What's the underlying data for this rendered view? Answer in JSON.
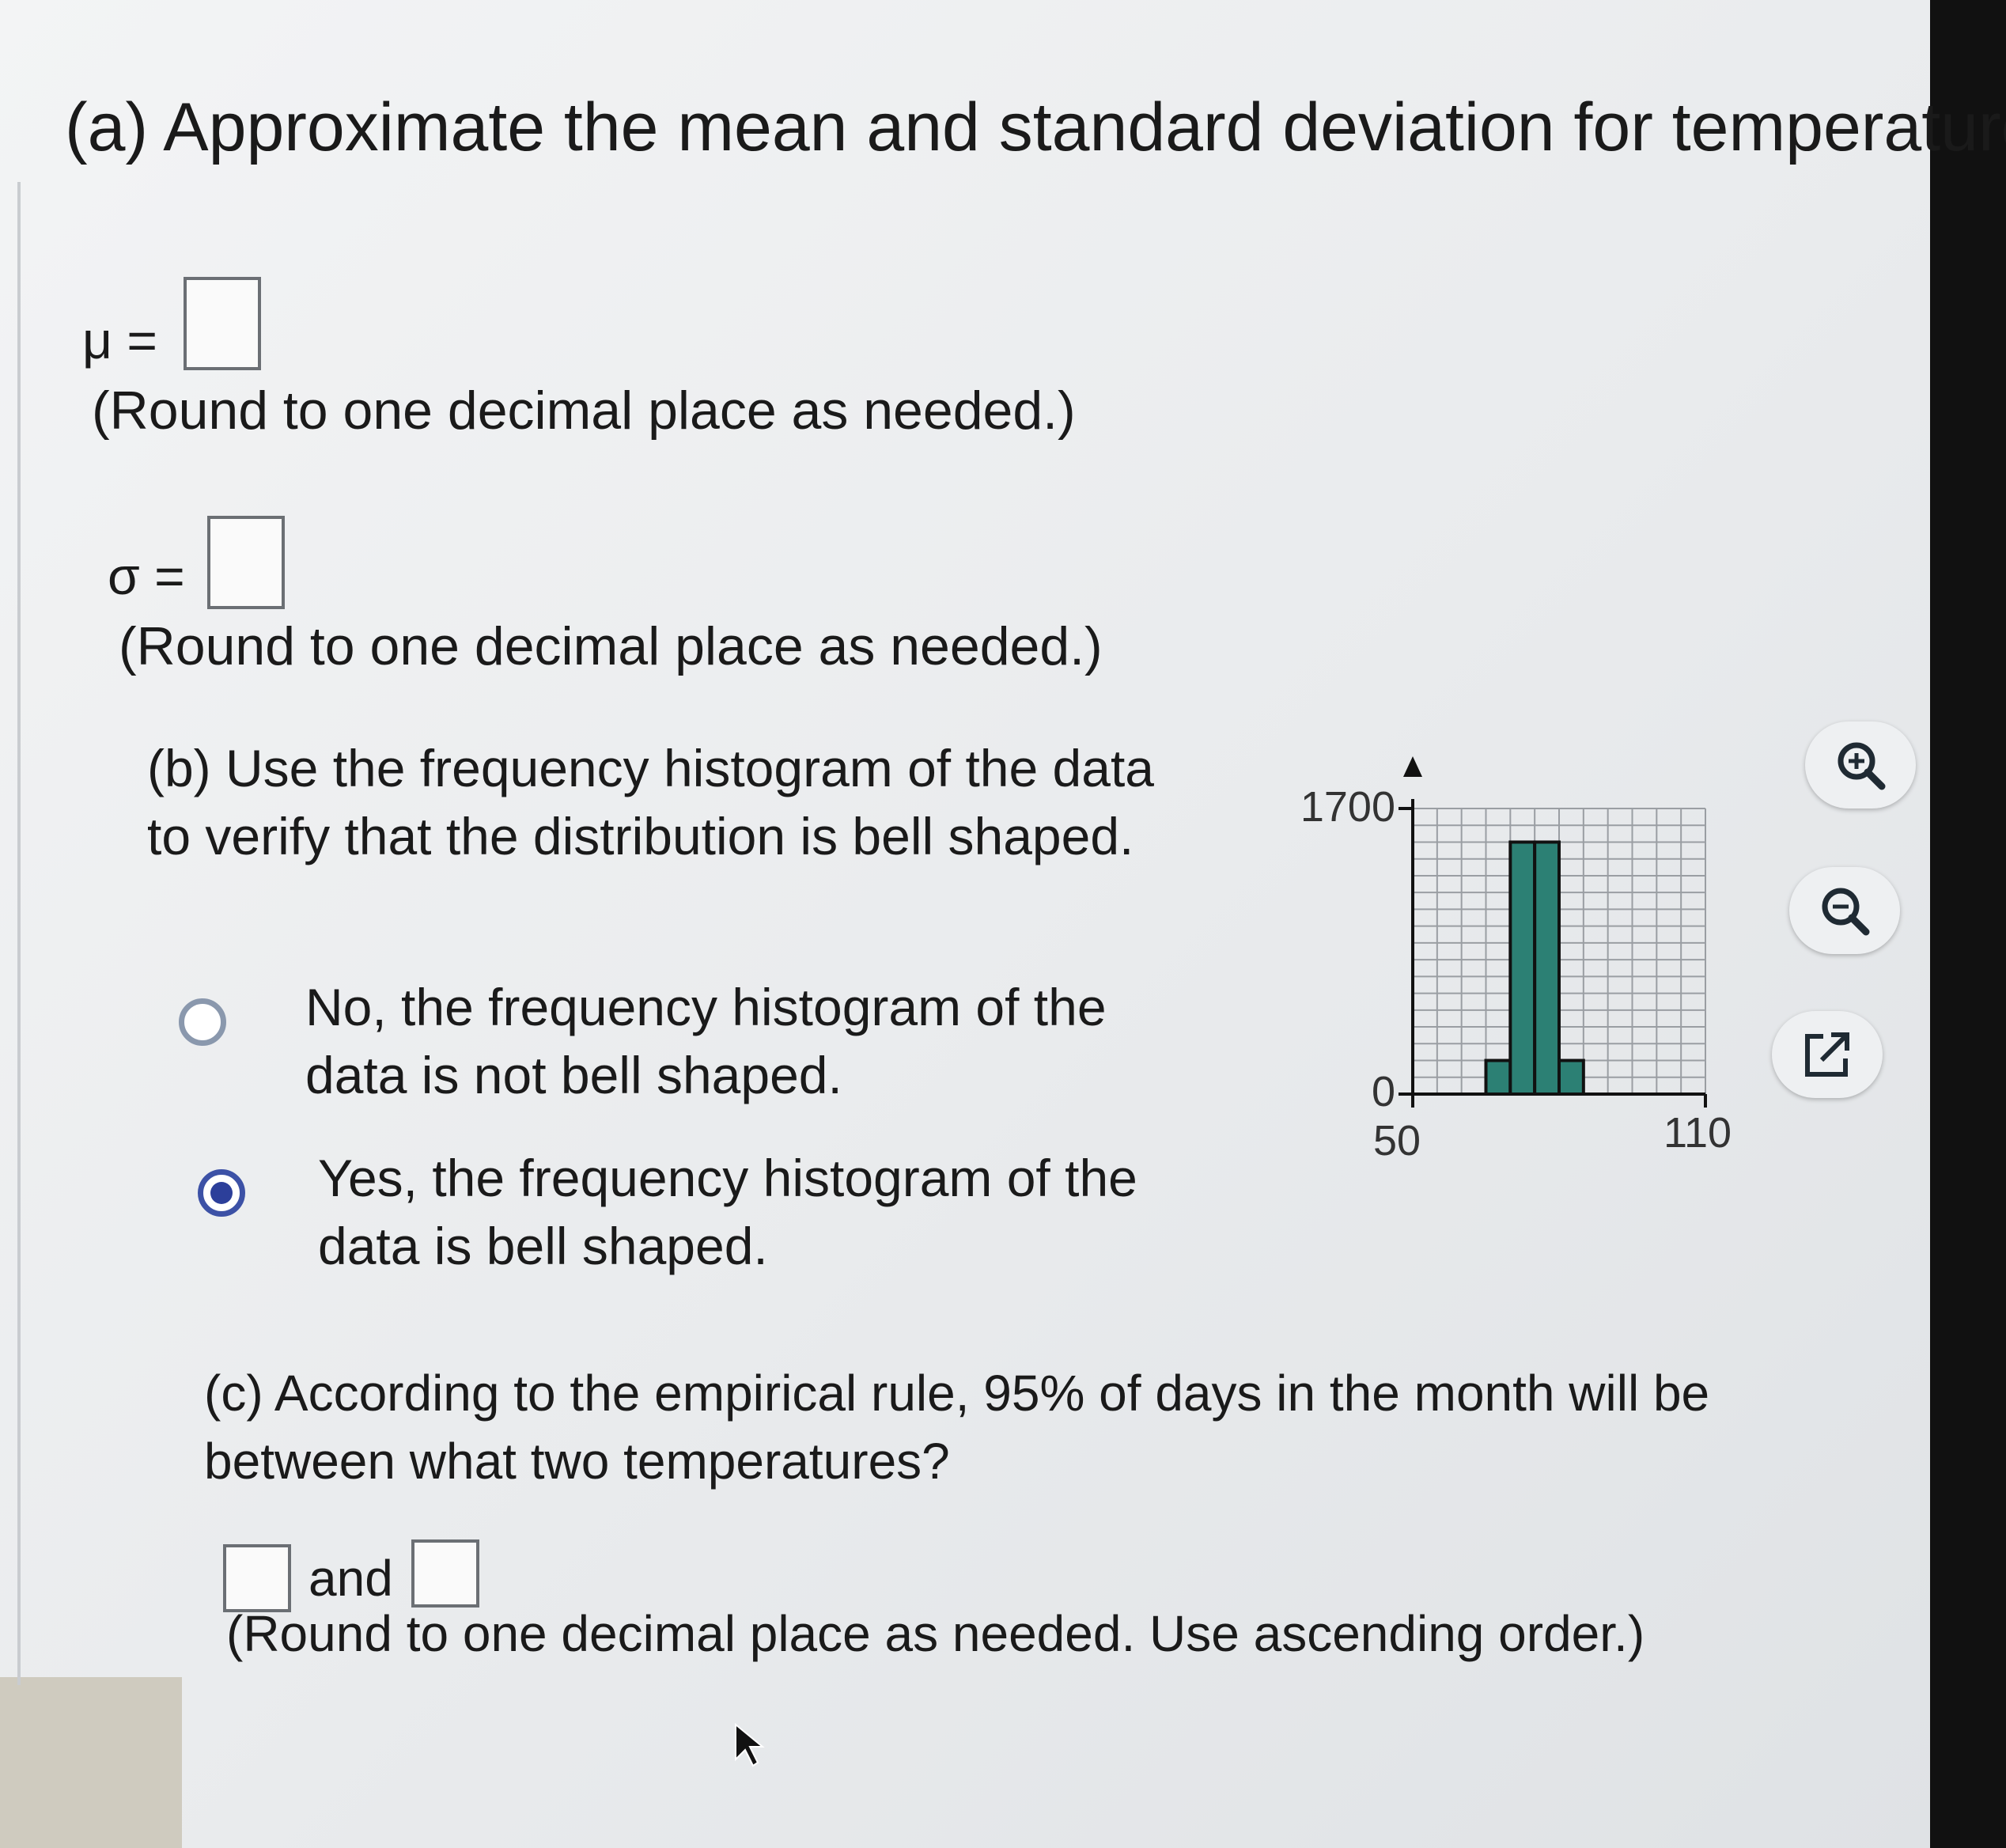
{
  "part_a": {
    "title": "(a) Approximate the mean and standard deviation for temperature.",
    "mu_label": "μ =",
    "sigma_label": "σ =",
    "round_note": "(Round to one decimal place as needed.)"
  },
  "part_b": {
    "prompt_line1": "(b) Use the frequency histogram of the data",
    "prompt_line2": "to verify that the distribution is bell shaped.",
    "options": [
      {
        "line1": "No, the frequency histogram of the",
        "line2": "data is not bell shaped.",
        "selected": false
      },
      {
        "line1": "Yes, the frequency histogram of the",
        "line2": "data is bell shaped.",
        "selected": true
      }
    ]
  },
  "part_c": {
    "prompt_line1": "(c) According to the empirical rule, 95% of days in the month will be",
    "prompt_line2": "between what two temperatures?",
    "and_label": "and",
    "round_note": "(Round to one decimal place as needed. Use ascending order.)"
  },
  "icons": [
    "zoom-in-icon",
    "zoom-out-icon",
    "external-link-icon",
    "cursor-arrow-icon"
  ],
  "colors": {
    "bar": "#2c8074",
    "selected_radio": "#2c3f9a",
    "unselected_radio": "#8a98ad"
  },
  "chart_data": {
    "type": "bar",
    "bins": [
      [
        60,
        65
      ],
      [
        65,
        70
      ],
      [
        70,
        75
      ],
      [
        75,
        80
      ],
      [
        80,
        85
      ],
      [
        85,
        90
      ]
    ],
    "values": [
      0,
      200,
      1500,
      1500,
      200,
      0
    ],
    "ylim": [
      0,
      1700
    ],
    "xlim": [
      50,
      110
    ],
    "ytick_labels": [
      "0",
      "1700"
    ],
    "xtick_labels": [
      "50",
      "110"
    ],
    "grid": true
  }
}
